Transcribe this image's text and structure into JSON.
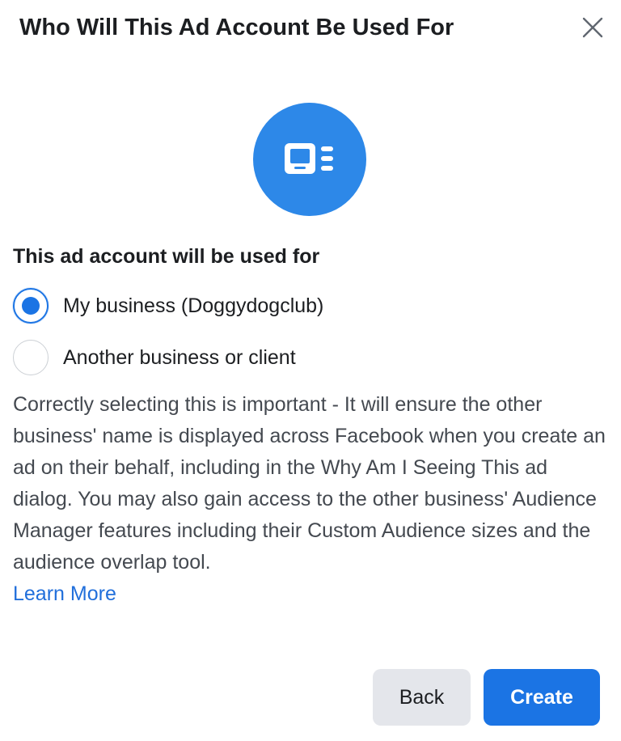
{
  "dialog": {
    "title": "Who Will This Ad Account Be Used For",
    "close_icon": "close-icon",
    "hero_icon": "ad-account-icon",
    "accent_color": "#1b74e4",
    "hero_color": "#2d88e8"
  },
  "usage": {
    "label": "This ad account will be used for",
    "options": [
      {
        "label": "My business (Doggydogclub)",
        "selected": true
      },
      {
        "label": "Another business or client",
        "selected": false
      }
    ]
  },
  "description": {
    "text": "Correctly selecting this is important - It will ensure the other business' name is displayed across Facebook when you create an ad on their behalf, including in the Why Am I Seeing This ad dialog. You may also gain access to the other business' Audience Manager features including their Custom Audience sizes and the audience overlap tool.",
    "learn_more": "Learn More"
  },
  "footer": {
    "back_label": "Back",
    "create_label": "Create"
  }
}
